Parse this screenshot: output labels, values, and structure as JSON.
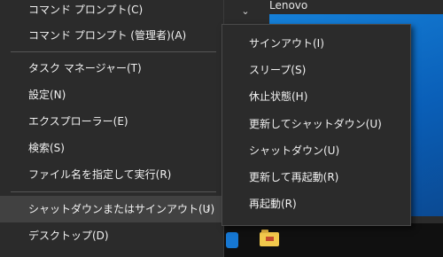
{
  "desktop": {
    "tile_label": "Lenovo"
  },
  "main_menu": {
    "items": [
      {
        "label": "コマンド プロンプト(C)"
      },
      {
        "label": "コマンド プロンプト (管理者)(A)"
      },
      {
        "label": "タスク マネージャー(T)"
      },
      {
        "label": "設定(N)"
      },
      {
        "label": "エクスプローラー(E)"
      },
      {
        "label": "検索(S)"
      },
      {
        "label": "ファイル名を指定して実行(R)"
      },
      {
        "label": "シャットダウンまたはサインアウト(U)"
      },
      {
        "label": "デスクトップ(D)"
      }
    ],
    "submenu_arrow_icon": "chevron-right-icon"
  },
  "submenu": {
    "items": [
      {
        "label": "サインアウト(I)"
      },
      {
        "label": "スリープ(S)"
      },
      {
        "label": "休止状態(H)"
      },
      {
        "label": "更新してシャットダウン(U)"
      },
      {
        "label": "シャットダウン(U)"
      },
      {
        "label": "更新して再起動(R)"
      },
      {
        "label": "再起動(R)"
      }
    ]
  },
  "colors": {
    "menu_background": "#2b2b2b",
    "highlight": "#414141",
    "separator": "#555555",
    "text": "#f2f2f2",
    "wallpaper_accent": "#0a5fb8"
  },
  "taskbar": {
    "icons": [
      "app-icon",
      "file-explorer-folder-icon"
    ]
  }
}
